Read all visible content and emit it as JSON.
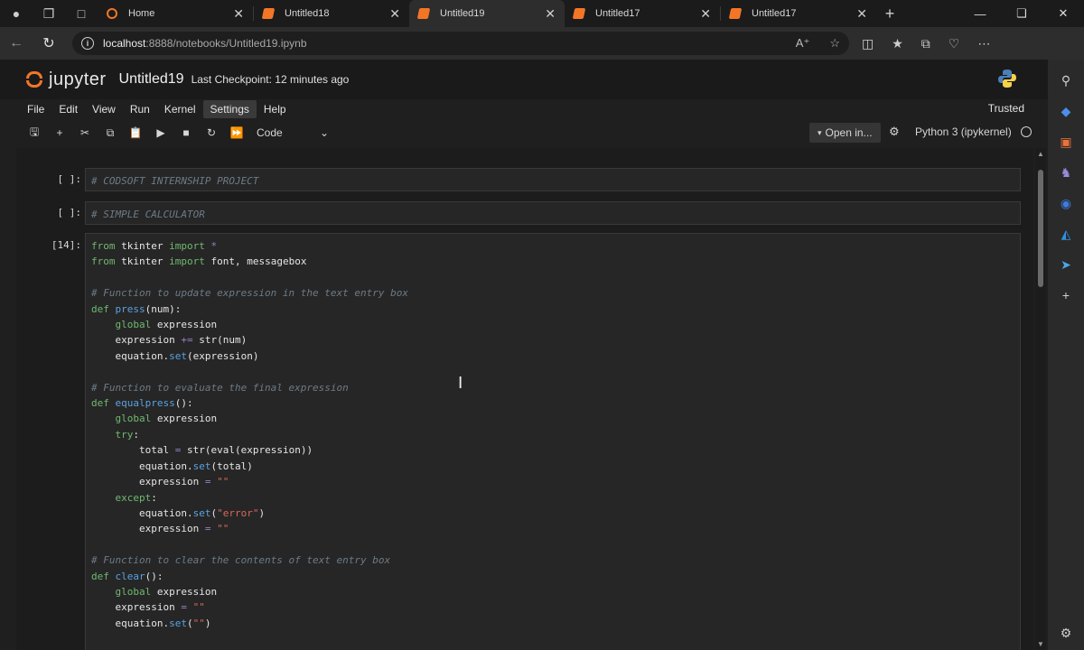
{
  "browser": {
    "tabs": [
      {
        "label": "Home",
        "favicon": "jupyter-icon",
        "active": false
      },
      {
        "label": "Untitled18",
        "favicon": "notebook-icon",
        "active": false
      },
      {
        "label": "Untitled19",
        "favicon": "notebook-icon",
        "active": true
      },
      {
        "label": "Untitled17",
        "favicon": "notebook-icon",
        "active": false
      },
      {
        "label": "Untitled17",
        "favicon": "notebook-icon",
        "active": false
      }
    ],
    "url_host": "localhost",
    "url_path": ":8888/notebooks/Untitled19.ipynb"
  },
  "jupyter": {
    "logo_text": "jupyter",
    "notebook_title": "Untitled19",
    "checkpoint": "Last Checkpoint: 12 minutes ago",
    "trusted": "Trusted",
    "menu": [
      "File",
      "Edit",
      "View",
      "Run",
      "Kernel",
      "Settings",
      "Help"
    ],
    "highlighted_menu": "Settings",
    "cell_type": "Code",
    "open_in": "Open in...",
    "kernel": "Python 3 (ipykernel)"
  },
  "cells": [
    {
      "prompt": "[ ]:",
      "text": "# CODSOFT INTERNSHIP PROJECT"
    },
    {
      "prompt": "[ ]:",
      "text": "# SIMPLE CALCULATOR"
    },
    {
      "prompt": "[14]:",
      "lines": [
        "from tkinter import *",
        "from tkinter import font, messagebox",
        "",
        "# Function to update expression in the text entry box",
        "def press(num):",
        "    global expression",
        "    expression += str(num)",
        "    equation.set(expression)",
        "",
        "# Function to evaluate the final expression",
        "def equalpress():",
        "    global expression",
        "    try:",
        "        total = str(eval(expression))",
        "        equation.set(total)",
        "        expression = \"\"",
        "    except:",
        "        equation.set(\"error\")",
        "        expression = \"\"",
        "",
        "# Function to clear the contents of text entry box",
        "def clear():",
        "    global expression",
        "    expression = \"\"",
        "    equation.set(\"\")"
      ]
    }
  ],
  "colors": {
    "accent": "#f37626",
    "background": "#1f1f1f",
    "keyword": "#4fa6d6",
    "comment": "#6d7b86",
    "string": "#d46a5a"
  }
}
